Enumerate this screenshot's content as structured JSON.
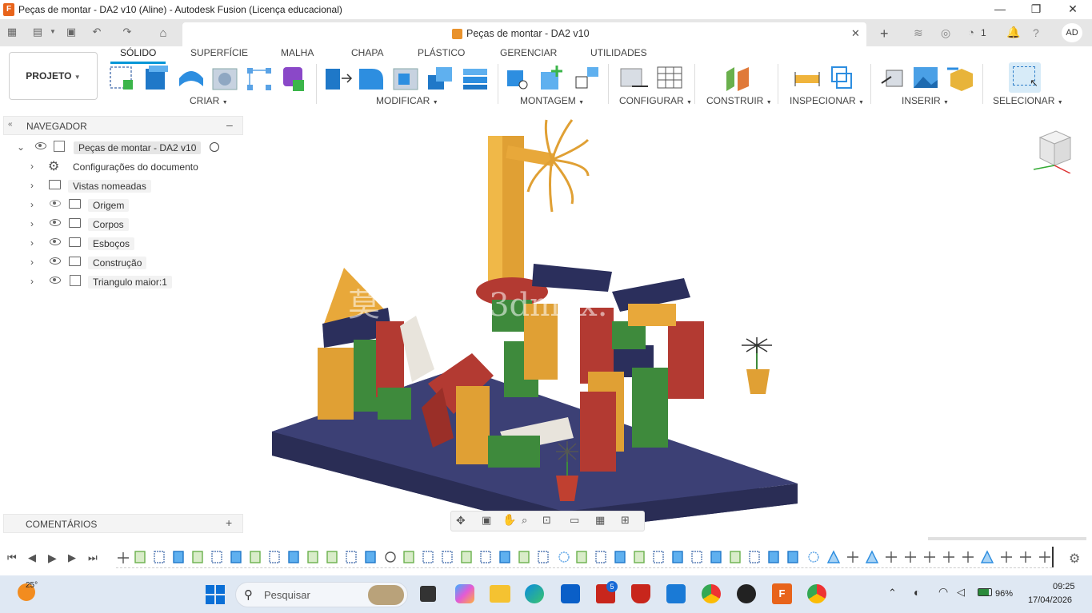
{
  "window": {
    "title": "Peças de montar - DA2 v10 (Aline) - Autodesk Fusion (Licença educacional)",
    "minimize": "—",
    "maximize": "❐",
    "close": "✕"
  },
  "document_tab": {
    "label": "Peças de montar - DA2 v10",
    "close": "✕",
    "jobs_count": "1",
    "user_initials": "AD"
  },
  "workspace": {
    "selector_label": "PROJETO",
    "tabs": [
      "SÓLIDO",
      "SUPERFÍCIE",
      "MALHA",
      "CHAPA",
      "PLÁSTICO",
      "GERENCIAR",
      "UTILIDADES"
    ],
    "active_tab": "SÓLIDO"
  },
  "tool_groups": [
    "CRIAR",
    "MODIFICAR",
    "MONTAGEM",
    "CONFIGURAR",
    "CONSTRUIR",
    "INSPECIONAR",
    "INSERIR",
    "SELECIONAR"
  ],
  "browser": {
    "title": "NAVEGADOR",
    "root": "Peças de montar - DA2 v10",
    "items": [
      {
        "label": "Configurações do documento",
        "icon": "gear-icon"
      },
      {
        "label": "Vistas nomeadas",
        "icon": "folder-icon"
      },
      {
        "label": "Origem",
        "icon": "folder-icon",
        "hidden": true
      },
      {
        "label": "Corpos",
        "icon": "folder-icon"
      },
      {
        "label": "Esboços",
        "icon": "folder-icon"
      },
      {
        "label": "Construção",
        "icon": "folder-icon"
      },
      {
        "label": "Triangulo maior:1",
        "icon": "component-icon"
      }
    ],
    "comments_label": "COMENTÁRIOS"
  },
  "watermark": "莫 www. 3dmox.",
  "colors": {
    "accent": "#0696d7",
    "base_plate": "#363a6b",
    "yellow": "#e8a83a",
    "green": "#4a8a3a",
    "red": "#b33a32",
    "navy": "#2b2f5c",
    "white_block": "#e8e4dc"
  },
  "taskbar": {
    "weather": "25°",
    "search_placeholder": "Pesquisar",
    "badge_l": "5",
    "battery": "96%",
    "time": "09:25",
    "date": "17/04/2026"
  }
}
